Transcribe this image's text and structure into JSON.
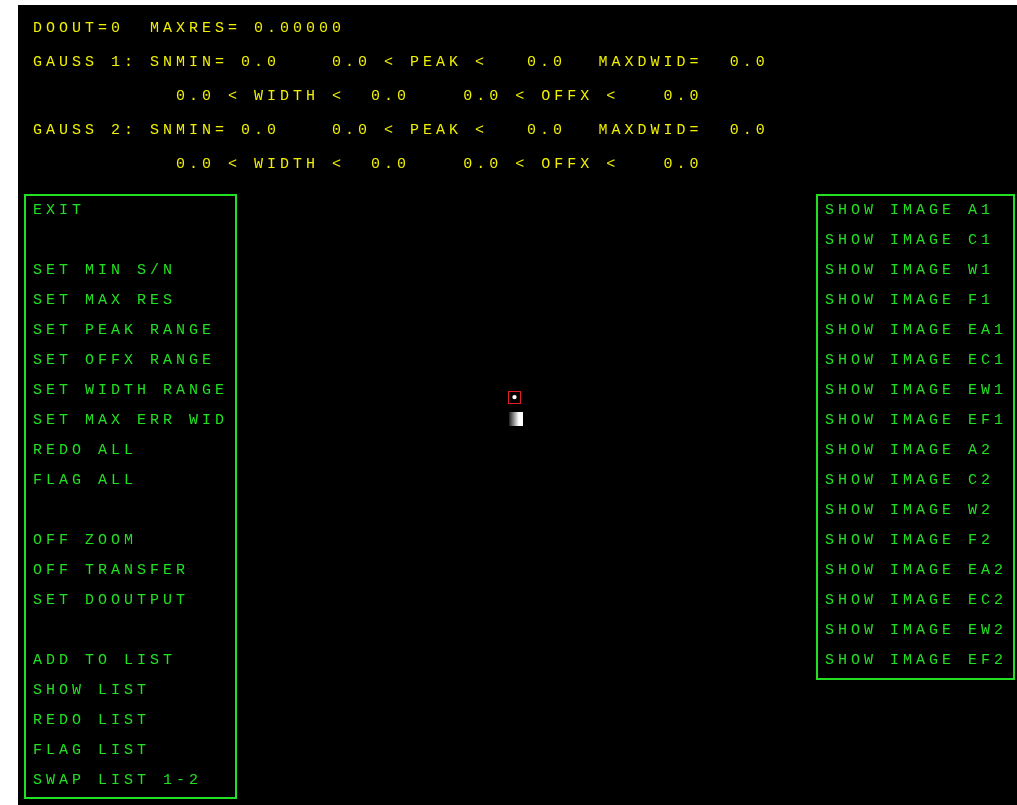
{
  "status_lines": [
    {
      "kind": "status",
      "segments": [
        "DOOUT=0",
        "MAXRES=",
        "0.00000"
      ]
    },
    {
      "kind": "gauss",
      "segments": [
        "GAUSS 1:",
        "SNMIN=",
        "0.0",
        "0.0 < PEAK <",
        "0.0",
        "MAXDWID=",
        "0.0"
      ]
    },
    {
      "kind": "range",
      "segments": [
        "0.0 < WIDTH <",
        "0.0",
        "0.0 < OFFX <",
        "0.0"
      ]
    },
    {
      "kind": "gauss",
      "segments": [
        "GAUSS 2:",
        "SNMIN=",
        "0.0",
        "0.0 < PEAK <",
        "0.0",
        "MAXDWID=",
        "0.0"
      ]
    },
    {
      "kind": "range",
      "segments": [
        "0.0 < WIDTH <",
        "0.0",
        "0.0 < OFFX <",
        "0.0"
      ]
    }
  ],
  "left_menu": {
    "groups": [
      [
        "EXIT"
      ],
      [
        "SET MIN S/N",
        "SET MAX RES",
        "SET PEAK RANGE",
        "SET OFFX RANGE",
        "SET WIDTH RANGE",
        "SET MAX ERR WID",
        "REDO ALL",
        "FLAG ALL"
      ],
      [
        "OFF ZOOM",
        "OFF TRANSFER",
        "SET DOOUTPUT"
      ],
      [
        "ADD TO LIST",
        "SHOW LIST",
        "REDO LIST",
        "FLAG LIST",
        "SWAP LIST 1-2"
      ]
    ]
  },
  "right_menu": {
    "items": [
      "SHOW IMAGE A1",
      "SHOW IMAGE C1",
      "SHOW IMAGE W1",
      "SHOW IMAGE F1",
      "SHOW IMAGE EA1",
      "SHOW IMAGE EC1",
      "SHOW IMAGE EW1",
      "SHOW IMAGE EF1",
      "SHOW IMAGE A2",
      "SHOW IMAGE C2",
      "SHOW IMAGE W2",
      "SHOW IMAGE F2",
      "SHOW IMAGE EA2",
      "SHOW IMAGE EC2",
      "SHOW IMAGE EW2",
      "SHOW IMAGE EF2"
    ]
  }
}
